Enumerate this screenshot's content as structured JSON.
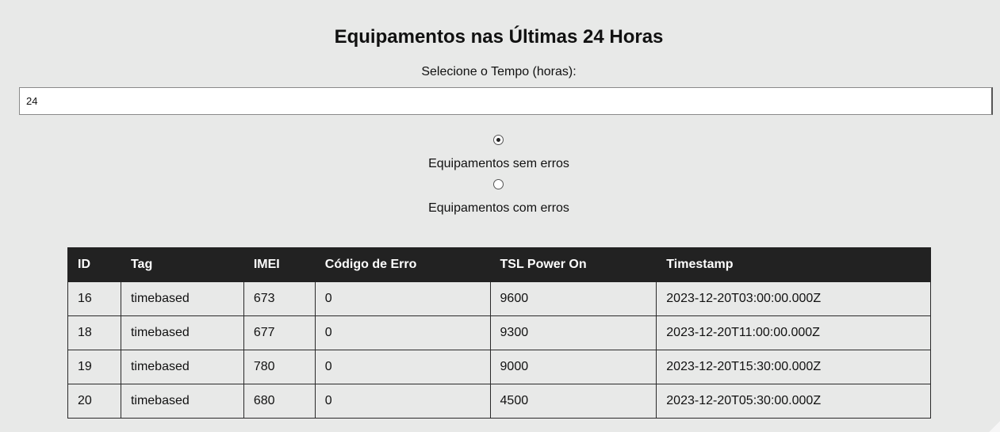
{
  "page": {
    "title": "Equipamentos nas Últimas 24 Horas"
  },
  "time_filter": {
    "label": "Selecione o Tempo (horas):",
    "value": "24"
  },
  "filters": {
    "options": [
      {
        "label": "Equipamentos sem erros",
        "selected": true
      },
      {
        "label": "Equipamentos com erros",
        "selected": false
      }
    ]
  },
  "table": {
    "columns": [
      "ID",
      "Tag",
      "IMEI",
      "Código de Erro",
      "TSL Power On",
      "Timestamp"
    ],
    "rows": [
      [
        "16",
        "timebased",
        "673",
        "0",
        "9600",
        "2023-12-20T03:00:00.000Z"
      ],
      [
        "18",
        "timebased",
        "677",
        "0",
        "9300",
        "2023-12-20T11:00:00.000Z"
      ],
      [
        "19",
        "timebased",
        "780",
        "0",
        "9000",
        "2023-12-20T15:30:00.000Z"
      ],
      [
        "20",
        "timebased",
        "680",
        "0",
        "4500",
        "2023-12-20T05:30:00.000Z"
      ]
    ]
  },
  "colors": {
    "background": "#e8e9e8",
    "table_header": "#222222",
    "table_header_text": "#ffffff"
  }
}
